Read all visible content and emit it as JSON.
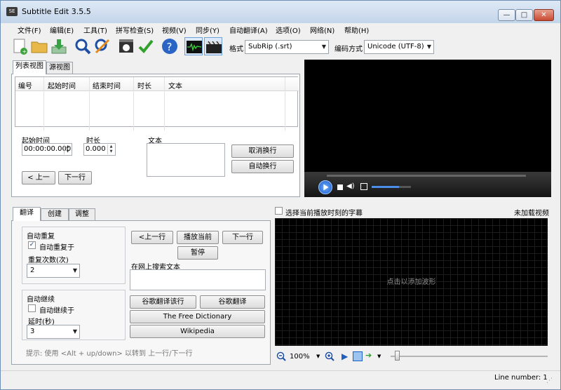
{
  "window": {
    "title": "Subtitle Edit 3.5.5",
    "app_icon_text": "SE"
  },
  "window_controls": {
    "minimize": "—",
    "maximize": "□",
    "close": "✕"
  },
  "menu": [
    "文件(F)",
    "编辑(E)",
    "工具(T)",
    "拼写检查(S)",
    "视频(V)",
    "同步(Y)",
    "自动翻译(A)",
    "选项(O)",
    "网络(N)",
    "帮助(H)"
  ],
  "toolbar": {
    "format_label": "格式",
    "format_value": "SubRip (.srt)",
    "encoding_label": "编码方式",
    "encoding_value": "Unicode (UTF-8)"
  },
  "subtitle_tabs": [
    "列表视图",
    "源视图"
  ],
  "table": {
    "columns": [
      "编号",
      "起始时间",
      "结束时间",
      "时长",
      "文本"
    ]
  },
  "editor": {
    "start_label": "起始时间",
    "start_value": "00:00:00.000",
    "duration_label": "时长",
    "duration_value": "0.000",
    "text_label": "文本",
    "unbreak_btn": "取消换行",
    "autobreak_btn": "自动换行",
    "prev_btn": "< 上一",
    "next_btn": "下一行"
  },
  "bottom_tabs": [
    "翻译",
    "创建",
    "调整"
  ],
  "translate": {
    "auto_repeat_title": "自动重复",
    "auto_repeat_on": "自动重复于",
    "repeat_count_label": "重复次数(次)",
    "repeat_count_value": "2",
    "auto_continue_title": "自动继续",
    "auto_continue_on": "自动继续于",
    "delay_label": "延时(秒)",
    "delay_value": "3",
    "prev_line": "<上一行",
    "play_current": "播放当前",
    "next_line": "下一行",
    "pause": "暂停",
    "search_web_title": "在网上搜索文本",
    "google_translate_line": "谷歌翻译该行",
    "google_translate": "谷歌翻译",
    "free_dictionary": "The Free Dictionary",
    "wikipedia": "Wikipedia",
    "tip": "提示: 使用 <Alt + up/down> 以转到 上一行/下一行"
  },
  "waveform": {
    "select_current_label": "选择当前播放时刻的字幕",
    "no_video": "未加载视频",
    "click_hint": "点击以添加波形",
    "zoom_value": "100%"
  },
  "status": {
    "line_number": "Line number: 1"
  }
}
